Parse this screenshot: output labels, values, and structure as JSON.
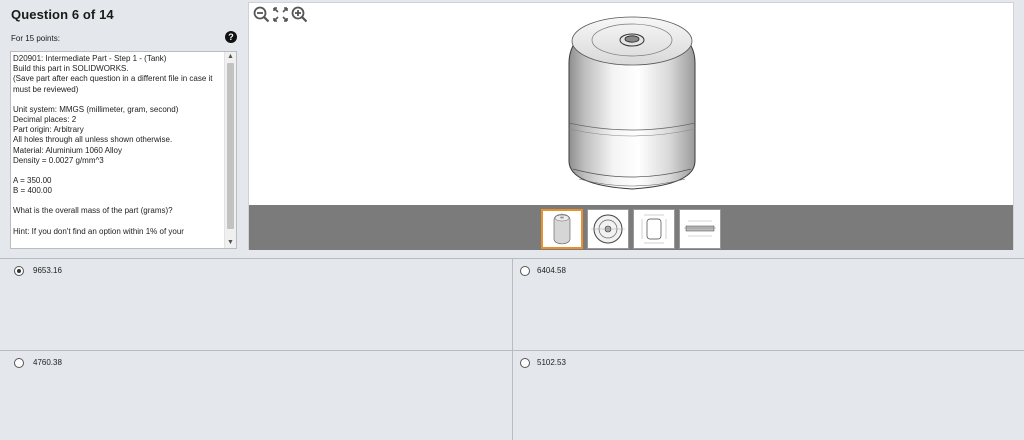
{
  "question": {
    "title": "Question 6 of 14",
    "points": "For 15 points:",
    "help_icon": "question-circle-icon",
    "description_lines": [
      "D20901:  Intermediate Part - Step 1 - (Tank)",
      "Build this part in SOLIDWORKS.",
      "(Save part after each question in a different file in case it",
      "must be reviewed)",
      "",
      "Unit system: MMGS (millimeter, gram, second)",
      "Decimal places: 2",
      "Part origin: Arbitrary",
      "All holes through all unless shown otherwise.",
      "Material: Aluminium 1060 Alloy",
      "Density = 0.0027 g/mm^3",
      "",
      "A = 350.00",
      "B = 400.00",
      "",
      "What is the overall mass of the part (grams)?",
      "",
      "Hint: If you don't find an option within 1% of your"
    ]
  },
  "viewer": {
    "tools": [
      "zoom-out-icon",
      "fit-view-icon",
      "zoom-in-icon"
    ],
    "thumbnails": [
      "isometric-view",
      "top-view",
      "front-section-view",
      "side-drawing-view"
    ],
    "active_thumbnail": 0,
    "accent_color": "#e8912d"
  },
  "answers": [
    {
      "value": "9653.16",
      "selected": true
    },
    {
      "value": "6404.58",
      "selected": false
    },
    {
      "value": "4760.38",
      "selected": false
    },
    {
      "value": "5102.53",
      "selected": false
    }
  ]
}
